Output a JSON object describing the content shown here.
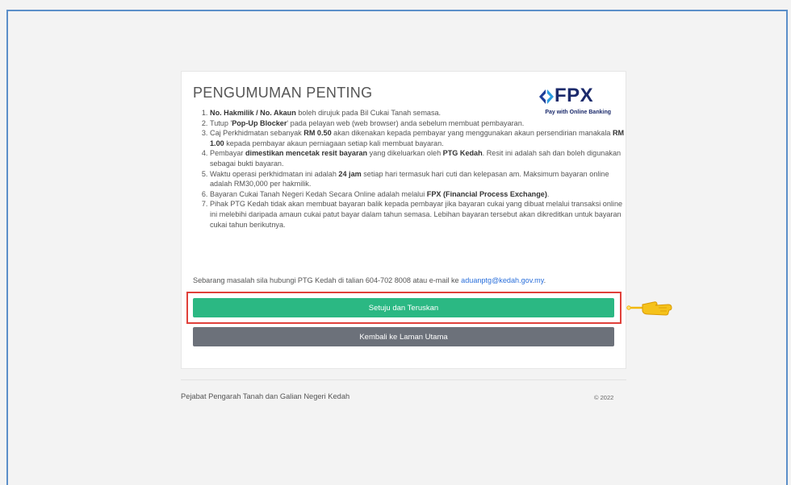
{
  "notice": {
    "title": "PENGUMUMAN PENTING",
    "items": [
      {
        "parts": [
          {
            "b": "No. Hakmilik / No. Akaun"
          },
          {
            "t": " boleh dirujuk pada Bil Cukai Tanah semasa."
          }
        ]
      },
      {
        "parts": [
          {
            "t": "Tutup '"
          },
          {
            "b": "Pop-Up Blocker"
          },
          {
            "t": "' pada pelayan web (web browser) anda sebelum membuat pembayaran."
          }
        ]
      },
      {
        "parts": [
          {
            "t": "Caj Perkhidmatan sebanyak "
          },
          {
            "b": "RM 0.50"
          },
          {
            "t": " akan dikenakan kepada pembayar yang menggunakan akaun persendirian manakala "
          },
          {
            "b": "RM 1.00"
          },
          {
            "t": " kepada pembayar akaun perniagaan setiap kali membuat bayaran."
          }
        ]
      },
      {
        "parts": [
          {
            "t": "Pembayar "
          },
          {
            "b": "dimestikan mencetak resit bayaran"
          },
          {
            "t": " yang dikeluarkan oleh "
          },
          {
            "b": "PTG Kedah"
          },
          {
            "t": ". Resit ini adalah sah dan boleh digunakan sebagai bukti bayaran."
          }
        ]
      },
      {
        "parts": [
          {
            "t": "Waktu operasi perkhidmatan ini adalah "
          },
          {
            "b": "24 jam"
          },
          {
            "t": " setiap hari termasuk hari cuti dan kelepasan am. Maksimum bayaran online adalah RM30,000 per hakmilik."
          }
        ]
      },
      {
        "parts": [
          {
            "t": "Bayaran Cukai Tanah Negeri Kedah Secara Online adalah melalui "
          },
          {
            "b": "FPX (Financial Process Exchange)"
          },
          {
            "t": "."
          }
        ]
      },
      {
        "parts": [
          {
            "t": "Pihak PTG Kedah tidak akan membuat bayaran balik kepada pembayar jika bayaran cukai yang dibuat melalui transaksi online ini melebihi daripada amaun cukai patut bayar dalam tahun semasa. Lebihan bayaran tersebut akan dikreditkan untuk bayaran cukai tahun berikutnya."
          }
        ]
      }
    ],
    "contact_text": "Sebarang masalah sila hubungi PTG Kedah di talian 604-702 8008 atau e-mail ke ",
    "contact_email": "aduanptg@kedah.gov.my",
    "contact_end": "."
  },
  "logo": {
    "name": "FPX",
    "tagline": "Pay with Online Banking",
    "colors": {
      "blue": "#1b2a6b",
      "left": "#1f3f99",
      "right": "#2a9be0"
    }
  },
  "buttons": {
    "agree": "Setuju dan Teruskan",
    "back": "Kembali ke Laman Utama"
  },
  "footer": {
    "org": "Pejabat Pengarah Tanah dan Galian Negeri Kedah",
    "copyright": "© 2022"
  },
  "annotation": {
    "highlight_color": "#e0403a",
    "pointer_color": "#f2b807",
    "pointer_icon": "pointing-hand-icon"
  }
}
